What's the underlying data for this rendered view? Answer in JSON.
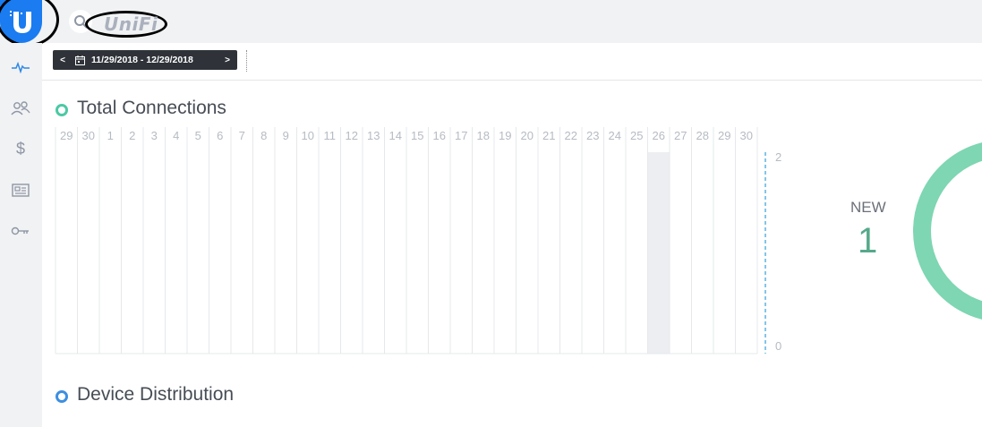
{
  "header": {
    "logo_text": "UniFi"
  },
  "toolbar": {
    "prev_label": "<",
    "next_label": ">",
    "date_range": "11/29/2018 - 12/29/2018"
  },
  "sidebar": {
    "items": [
      {
        "icon": "activity-icon"
      },
      {
        "icon": "users-icon"
      },
      {
        "icon": "dollar-icon"
      },
      {
        "icon": "id-card-icon"
      },
      {
        "icon": "key-icon"
      }
    ]
  },
  "sections": {
    "connections_title": "Total Connections",
    "distribution_title": "Device Distribution"
  },
  "stats": {
    "new_label": "NEW",
    "new_value": "1"
  },
  "colors": {
    "brand": "#1a7cf0",
    "connections_dot": "#4cc9a4",
    "distribution_dot": "#3d8fe0",
    "donut": "#7ed6b2",
    "highlight_column": "#eceef1"
  },
  "chart_data": {
    "type": "bar",
    "categories": [
      "29",
      "30",
      "1",
      "2",
      "3",
      "4",
      "5",
      "6",
      "7",
      "8",
      "9",
      "10",
      "11",
      "12",
      "13",
      "14",
      "15",
      "16",
      "17",
      "18",
      "19",
      "20",
      "21",
      "22",
      "23",
      "24",
      "25",
      "26",
      "27",
      "28",
      "29",
      "30"
    ],
    "values": [
      0,
      0,
      0,
      0,
      0,
      0,
      0,
      0,
      0,
      0,
      0,
      0,
      0,
      0,
      0,
      0,
      0,
      0,
      0,
      0,
      0,
      0,
      0,
      0,
      0,
      0,
      0,
      0,
      0,
      0,
      0,
      0
    ],
    "highlighted_category_index": 27,
    "ylim": [
      0,
      2
    ],
    "y_ticks": [
      "2",
      "0"
    ],
    "grid": true,
    "title": "Total Connections"
  }
}
